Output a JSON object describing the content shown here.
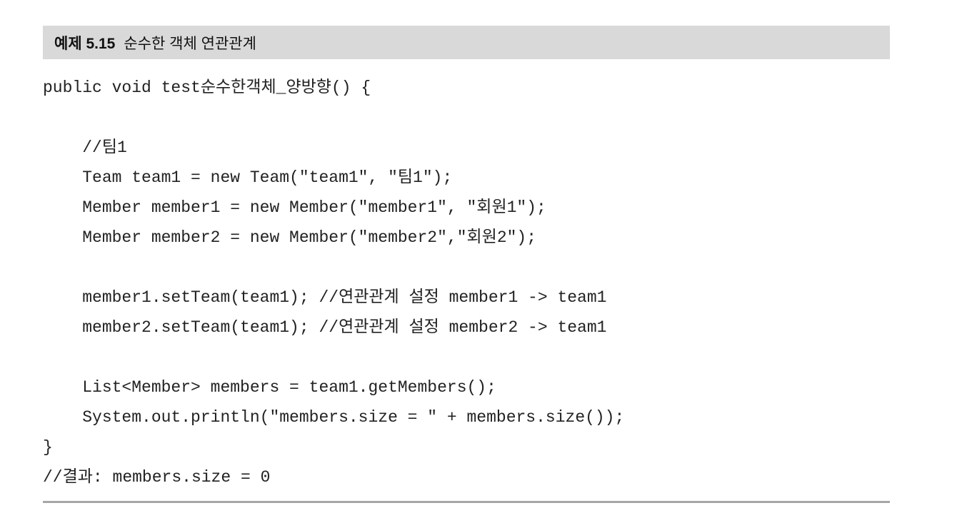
{
  "example": {
    "number": "예제 5.15",
    "title": "순수한 객체 연관관계"
  },
  "code_lines": [
    "public void test순수한객체_양방향() {",
    "",
    "    //팀1",
    "    Team team1 = new Team(\"team1\", \"팀1\");",
    "    Member member1 = new Member(\"member1\", \"회원1\");",
    "    Member member2 = new Member(\"member2\",\"회원2\");",
    "",
    "    member1.setTeam(team1); //연관관계 설정 member1 -> team1",
    "    member2.setTeam(team1); //연관관계 설정 member2 -> team1",
    "",
    "    List<Member> members = team1.getMembers();",
    "    System.out.println(\"members.size = \" + members.size());",
    "}",
    "//결과: members.size = 0"
  ]
}
